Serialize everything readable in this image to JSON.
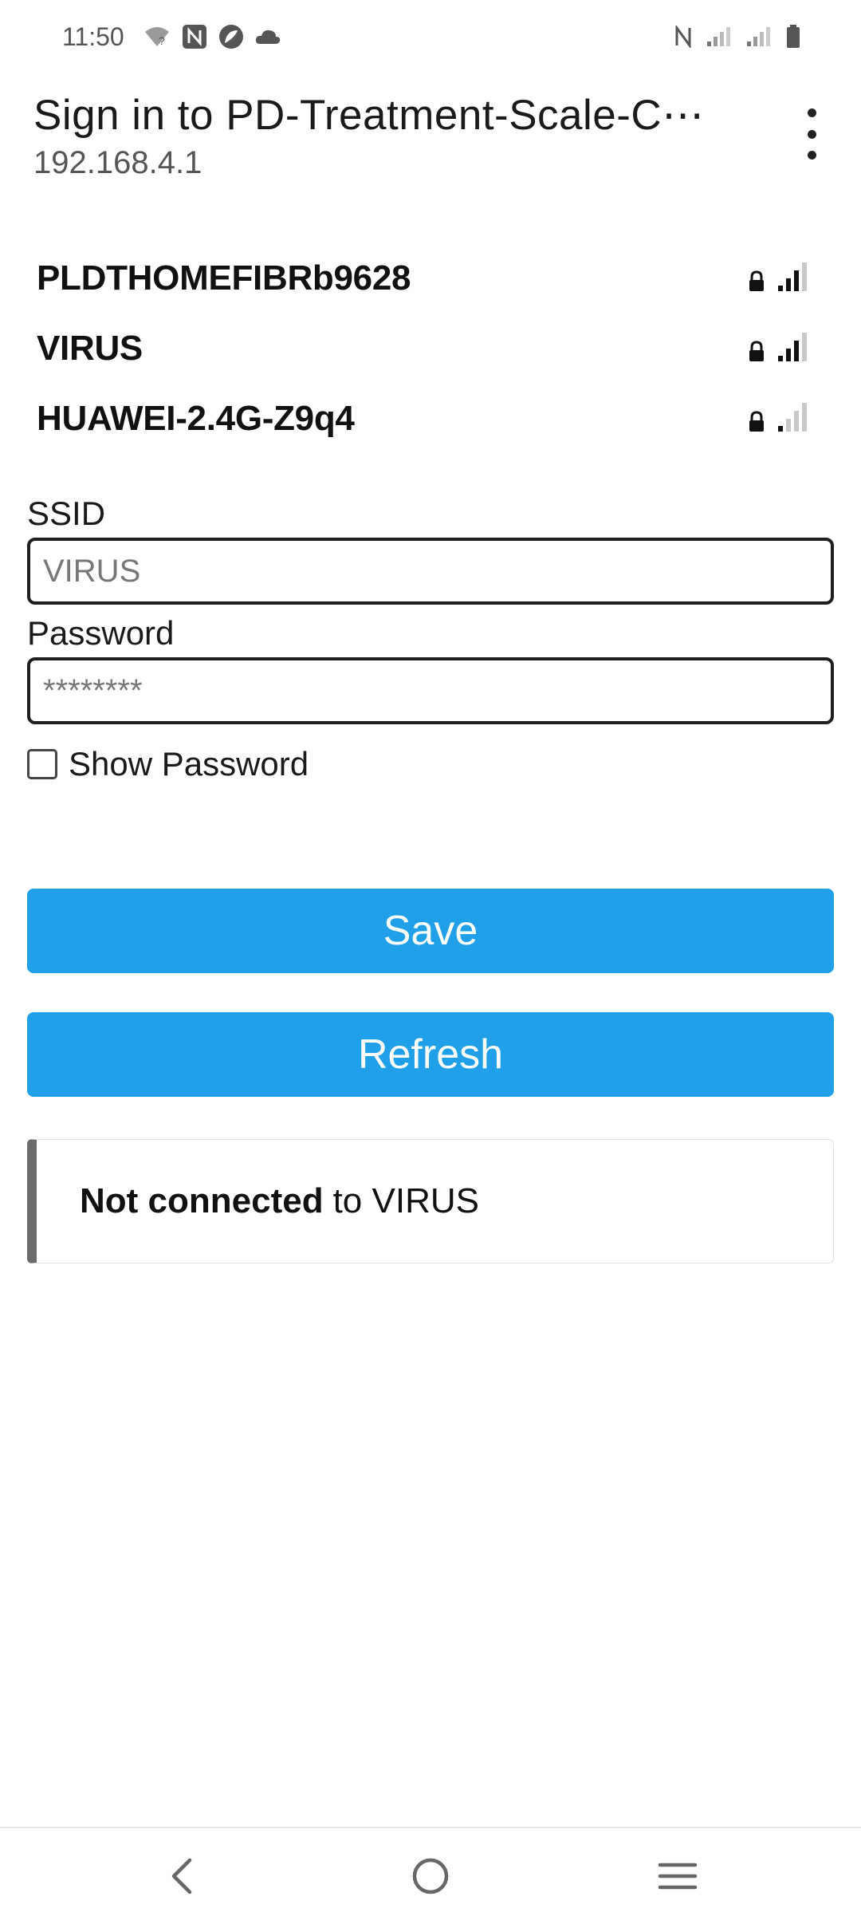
{
  "status_bar": {
    "time": "11:50",
    "left_icons": [
      "wifi-unknown-icon",
      "nfc-icon",
      "leaf-icon",
      "cloud-icon"
    ],
    "right_icons": [
      "nfc-icon",
      "signal-icon",
      "signal-icon",
      "battery-icon"
    ]
  },
  "header": {
    "title": "Sign in to PD-Treatment-Scale-C⋯",
    "subtitle": "192.168.4.1",
    "menu_icon": "more-vert-icon"
  },
  "networks": [
    {
      "name": "PLDTHOMEFIBRb9628",
      "locked": true,
      "signal_bars": 3
    },
    {
      "name": "VIRUS",
      "locked": true,
      "signal_bars": 3
    },
    {
      "name": "HUAWEI-2.4G-Z9q4",
      "locked": true,
      "signal_bars": 1
    }
  ],
  "form": {
    "ssid_label": "SSID",
    "ssid_value": "VIRUS",
    "password_label": "Password",
    "password_value": "********",
    "show_password_label": "Show Password",
    "show_password_checked": false
  },
  "buttons": {
    "save": "Save",
    "refresh": "Refresh"
  },
  "status": {
    "emphasis": "Not connected",
    "rest": "to VIRUS"
  },
  "colors": {
    "button_blue": "#1fa0e8",
    "status_border": "#6b6b6b"
  },
  "nav_bar": {
    "items": [
      "back-icon",
      "home-icon",
      "recents-icon"
    ]
  }
}
